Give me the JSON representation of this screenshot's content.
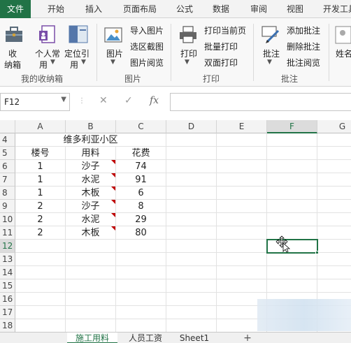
{
  "ribbon_tabs": [
    "文件",
    "开始",
    "插入",
    "页面布局",
    "公式",
    "数据",
    "审阅",
    "视图",
    "开发工具"
  ],
  "ribbon": {
    "collect_label_1": "收",
    "collect_label_2": "纳箱",
    "personal_label_1": "个人常",
    "personal_label_2": "用",
    "locate_label_1": "定位引",
    "locate_label_2": "用",
    "group_collect": "我的收纳箱",
    "picture_label": "图片",
    "import_picture": "导入图片",
    "region_screenshot": "选区截图",
    "picture_browse": "图片阅览",
    "group_picture": "图片",
    "print_label": "打印",
    "print_current_page": "打印当前页",
    "batch_print": "批量打印",
    "duplex_print": "双面打印",
    "group_print": "打印",
    "comment_label": "批注",
    "add_comment": "添加批注",
    "delete_comment": "删除批注",
    "comment_browse": "批注阅览",
    "group_comment": "批注",
    "name_label": "姓名"
  },
  "formula_bar": {
    "name_box": "F12",
    "cancel": "✕",
    "confirm": "✓",
    "fx": "fx",
    "formula": ""
  },
  "columns": [
    "A",
    "B",
    "C",
    "D",
    "E",
    "F",
    "G"
  ],
  "rows": [
    "4",
    "5",
    "6",
    "7",
    "8",
    "9",
    "10",
    "11",
    "12",
    "13",
    "14",
    "15",
    "16",
    "17",
    "18"
  ],
  "table": {
    "title": "维多利亚小区",
    "headers": [
      "楼号",
      "用料",
      "花费"
    ],
    "data": [
      [
        "1",
        "沙子",
        "74"
      ],
      [
        "1",
        "水泥",
        "91"
      ],
      [
        "1",
        "木板",
        "6"
      ],
      [
        "2",
        "沙子",
        "8"
      ],
      [
        "2",
        "水泥",
        "29"
      ],
      [
        "2",
        "木板",
        "80"
      ]
    ]
  },
  "sheets": [
    "施工用料",
    "人员工资",
    "Sheet1"
  ],
  "add_sheet": "+",
  "active_cell": "F12",
  "colors": {
    "accent": "#217346",
    "comment_marker": "#c00000"
  }
}
